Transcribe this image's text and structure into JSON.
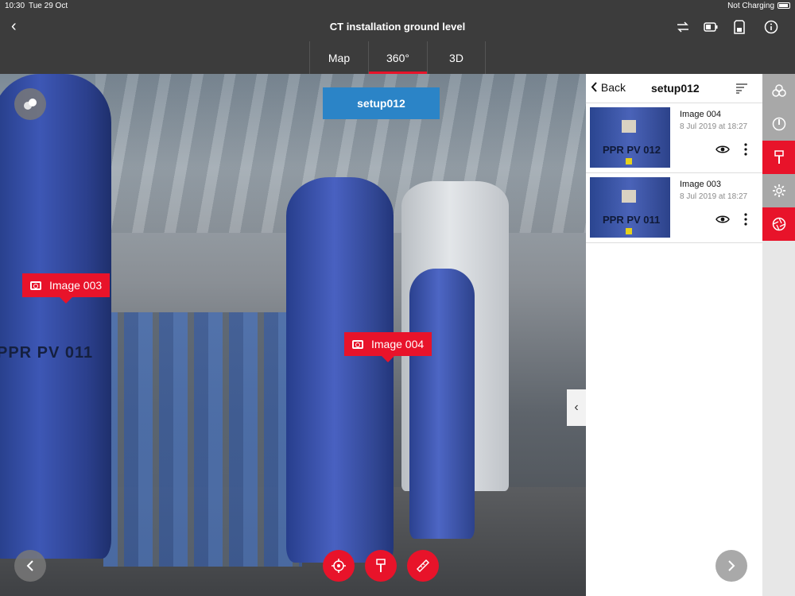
{
  "status": {
    "time": "10:30",
    "date": "Tue 29 Oct",
    "charge": "Not Charging"
  },
  "nav": {
    "back_symbol": "‹",
    "title": "CT installation ground level",
    "icons": [
      "sync-icon",
      "battery-icon",
      "sd-card-icon",
      "info-icon"
    ]
  },
  "tabs": [
    {
      "label": "Map",
      "active": false
    },
    {
      "label": "360°",
      "active": true
    },
    {
      "label": "3D",
      "active": false
    }
  ],
  "viewer": {
    "setup_label": "setup012",
    "tank_text": "PPR PV 011",
    "markers": [
      {
        "label": "Image 003"
      },
      {
        "label": "Image 004"
      }
    ],
    "collapse_symbol": "‹"
  },
  "panel": {
    "back_label": "Back",
    "title": "setup012",
    "items": [
      {
        "name": "Image 004",
        "date": "8 Jul 2019 at 18:27",
        "thumb_text": "PPR PV 012"
      },
      {
        "name": "Image 003",
        "date": "8 Jul 2019 at 18:27",
        "thumb_text": "PPR PV 011"
      }
    ]
  },
  "rail": {
    "items": [
      "layers-icon",
      "compass-icon",
      "marker-tool-icon",
      "settings-icon",
      "aperture-icon"
    ]
  },
  "colors": {
    "accent": "#e8132a",
    "setup_blue": "#2b84c7",
    "bar": "#3c3c3c"
  }
}
